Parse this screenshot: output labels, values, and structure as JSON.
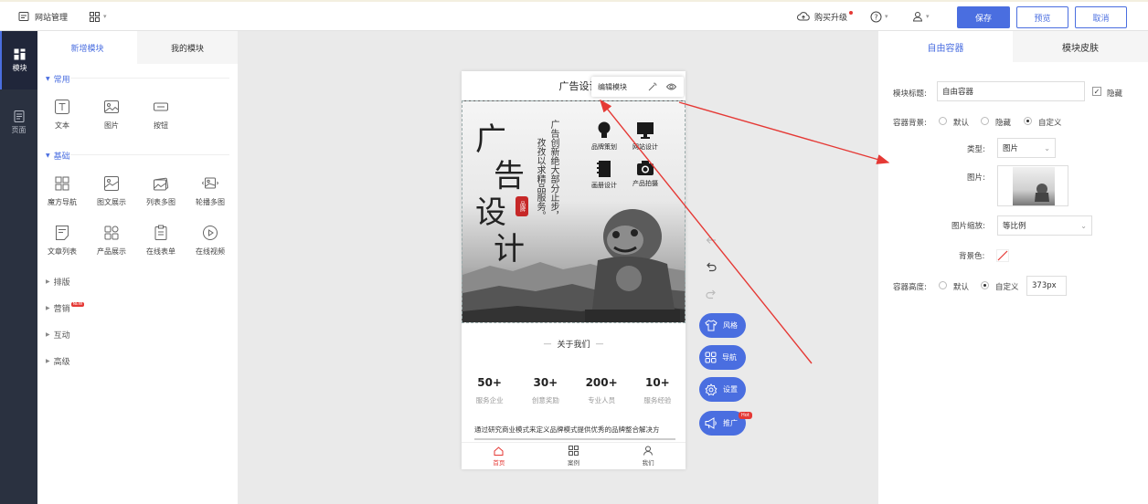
{
  "topbar": {
    "site_manage": "网站管理",
    "upgrade": "购买升级",
    "save": "保存",
    "preview": "预览",
    "cancel": "取消"
  },
  "leftnav": {
    "items": [
      {
        "label": "模块",
        "icon": "grid-icon"
      },
      {
        "label": "页面",
        "icon": "page-icon"
      }
    ]
  },
  "modpanel": {
    "tabs": [
      "新增模块",
      "我的模块"
    ],
    "sections": {
      "common": "常用",
      "basic": "基础",
      "layout": "排版",
      "marketing": "营销",
      "interact": "互动",
      "advanced": "高级"
    },
    "common_items": [
      "文本",
      "图片",
      "按钮"
    ],
    "basic_items": [
      "魔方导航",
      "图文展示",
      "列表多图",
      "轮播多图",
      "文章列表",
      "产品展示",
      "在线表单",
      "在线视频"
    ],
    "new_badge": "NEW"
  },
  "phone": {
    "header_title": "广告设计",
    "edit_module": "编辑模块",
    "banner": {
      "big_chars": [
        "广",
        "告",
        "设",
        "计"
      ],
      "seal": "品牌",
      "vertical_text": [
        "广告创新绝大部分止步，",
        "孜孜以求精品服务。"
      ],
      "services": [
        "品牌策划",
        "网站设计",
        "画册设计",
        "产品拍摄"
      ]
    },
    "about_title": "关于我们",
    "stats": [
      {
        "value": "50+",
        "label": "服务企业"
      },
      {
        "value": "30+",
        "label": "创意奖励"
      },
      {
        "value": "200+",
        "label": "专业人员"
      },
      {
        "value": "10+",
        "label": "服务经验"
      }
    ],
    "paragraph": "通过研究商业模式来定义品牌模式提供优秀的品牌整合解决方",
    "bottom_nav": [
      "首页",
      "案例",
      "我们"
    ]
  },
  "fabs": [
    {
      "label": "风格",
      "icon": "shirt-icon"
    },
    {
      "label": "导航",
      "icon": "nav-grid-icon"
    },
    {
      "label": "设置",
      "icon": "gear-icon"
    },
    {
      "label": "推广",
      "icon": "megaphone-icon",
      "badge": "Hot"
    }
  ],
  "rightpanel": {
    "tabs": [
      "自由容器",
      "模块皮肤"
    ],
    "module_title_label": "模块标题:",
    "module_title_value": "自由容器",
    "hide_label": "隐藏",
    "container_bg_label": "容器背景:",
    "bg_options": [
      "默认",
      "隐藏",
      "自定义"
    ],
    "type_label": "类型:",
    "type_value": "图片",
    "image_label": "图片:",
    "scale_label": "图片缩放:",
    "scale_value": "等比例",
    "bgcolor_label": "背景色:",
    "height_label": "容器高度:",
    "height_options": [
      "默认",
      "自定义"
    ],
    "height_value": "373px"
  },
  "colors": {
    "accent": "#4a6ee0",
    "arrow": "#e53935",
    "nav_bg": "#2a3140"
  }
}
